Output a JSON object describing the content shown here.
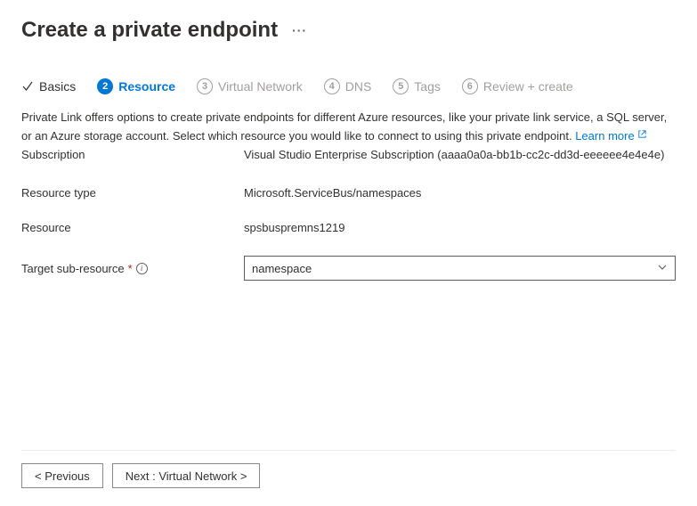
{
  "page": {
    "title": "Create a private endpoint"
  },
  "tabs": {
    "basics": {
      "label": "Basics"
    },
    "resource": {
      "num": "2",
      "label": "Resource"
    },
    "vnet": {
      "num": "3",
      "label": "Virtual Network"
    },
    "dns": {
      "num": "4",
      "label": "DNS"
    },
    "tags": {
      "num": "5",
      "label": "Tags"
    },
    "review": {
      "num": "6",
      "label": "Review + create"
    }
  },
  "intro": {
    "text": "Private Link offers options to create private endpoints for different Azure resources, like your private link service, a SQL server, or an Azure storage account. Select which resource you would like to connect to using this private endpoint. ",
    "learn_more": "Learn more"
  },
  "fields": {
    "subscription": {
      "label": "Subscription",
      "value": "Visual Studio Enterprise Subscription (aaaa0a0a-bb1b-cc2c-dd3d-eeeeee4e4e4e)"
    },
    "resource_type": {
      "label": "Resource type",
      "value": "Microsoft.ServiceBus/namespaces"
    },
    "resource": {
      "label": "Resource",
      "value": "spsbuspremns1219"
    },
    "target_sub": {
      "label": "Target sub-resource",
      "value": "namespace"
    }
  },
  "footer": {
    "prev": "< Previous",
    "next": "Next : Virtual Network >"
  }
}
